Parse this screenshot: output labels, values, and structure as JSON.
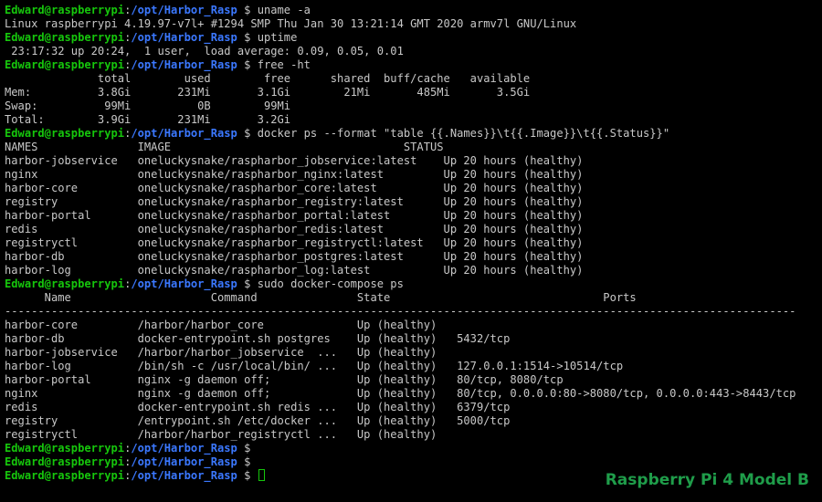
{
  "colors": {
    "background": "#000000",
    "text": "#c8c8c8",
    "user": "#16c60c",
    "path": "#3b78ff",
    "watermark": "#1f9d4a"
  },
  "prompt": {
    "user_host": "Edward@raspberrypi",
    "sep": ":",
    "path": "/opt/Harbor_Rasp",
    "symbol": " $ "
  },
  "lines": [
    {
      "type": "prompt",
      "cmd": "uname -a"
    },
    {
      "type": "out",
      "text": "Linux raspberrypi 4.19.97-v7l+ #1294 SMP Thu Jan 30 13:21:14 GMT 2020 armv7l GNU/Linux"
    },
    {
      "type": "prompt",
      "cmd": "uptime"
    },
    {
      "type": "out",
      "text": " 23:17:32 up 20:24,  1 user,  load average: 0.09, 0.05, 0.01"
    },
    {
      "type": "prompt",
      "cmd": "free -ht"
    },
    {
      "type": "out",
      "text": "              total        used        free      shared  buff/cache   available"
    },
    {
      "type": "out",
      "text": "Mem:          3.8Gi       231Mi       3.1Gi        21Mi       485Mi       3.5Gi"
    },
    {
      "type": "out",
      "text": "Swap:          99Mi          0B        99Mi"
    },
    {
      "type": "out",
      "text": "Total:        3.9Gi       231Mi       3.2Gi"
    },
    {
      "type": "prompt",
      "cmd": "docker ps --format \"table {{.Names}}\\t{{.Image}}\\t{{.Status}}\""
    },
    {
      "type": "out",
      "text": "NAMES               IMAGE                                   STATUS"
    },
    {
      "type": "out",
      "text": "harbor-jobservice   oneluckysnake/raspharbor_jobservice:latest    Up 20 hours (healthy)"
    },
    {
      "type": "out",
      "text": "nginx               oneluckysnake/raspharbor_nginx:latest         Up 20 hours (healthy)"
    },
    {
      "type": "out",
      "text": "harbor-core         oneluckysnake/raspharbor_core:latest          Up 20 hours (healthy)"
    },
    {
      "type": "out",
      "text": "registry            oneluckysnake/raspharbor_registry:latest      Up 20 hours (healthy)"
    },
    {
      "type": "out",
      "text": "harbor-portal       oneluckysnake/raspharbor_portal:latest        Up 20 hours (healthy)"
    },
    {
      "type": "out",
      "text": "redis               oneluckysnake/raspharbor_redis:latest         Up 20 hours (healthy)"
    },
    {
      "type": "out",
      "text": "registryctl         oneluckysnake/raspharbor_registryctl:latest   Up 20 hours (healthy)"
    },
    {
      "type": "out",
      "text": "harbor-db           oneluckysnake/raspharbor_postgres:latest      Up 20 hours (healthy)"
    },
    {
      "type": "out",
      "text": "harbor-log          oneluckysnake/raspharbor_log:latest           Up 20 hours (healthy)"
    },
    {
      "type": "prompt",
      "cmd": "sudo docker-compose ps"
    },
    {
      "type": "out",
      "text": "      Name                     Command               State                                Ports"
    },
    {
      "type": "out",
      "text": "-----------------------------------------------------------------------------------------------------------------------"
    },
    {
      "type": "out",
      "text": "harbor-core         /harbor/harbor_core              Up (healthy)"
    },
    {
      "type": "out",
      "text": "harbor-db           docker-entrypoint.sh postgres    Up (healthy)   5432/tcp"
    },
    {
      "type": "out",
      "text": "harbor-jobservice   /harbor/harbor_jobservice  ...   Up (healthy)"
    },
    {
      "type": "out",
      "text": "harbor-log          /bin/sh -c /usr/local/bin/ ...   Up (healthy)   127.0.0.1:1514->10514/tcp"
    },
    {
      "type": "out",
      "text": "harbor-portal       nginx -g daemon off;             Up (healthy)   80/tcp, 8080/tcp"
    },
    {
      "type": "out",
      "text": "nginx               nginx -g daemon off;             Up (healthy)   80/tcp, 0.0.0.0:80->8080/tcp, 0.0.0.0:443->8443/tcp"
    },
    {
      "type": "out",
      "text": "redis               docker-entrypoint.sh redis ...   Up (healthy)   6379/tcp"
    },
    {
      "type": "out",
      "text": "registry            /entrypoint.sh /etc/docker ...   Up (healthy)   5000/tcp"
    },
    {
      "type": "out",
      "text": "registryctl         /harbor/harbor_registryctl ...   Up (healthy)"
    },
    {
      "type": "prompt",
      "cmd": ""
    },
    {
      "type": "prompt",
      "cmd": ""
    },
    {
      "type": "prompt",
      "cmd": "",
      "cursor": true
    }
  ],
  "watermark": "Raspberry Pi 4 Model B"
}
